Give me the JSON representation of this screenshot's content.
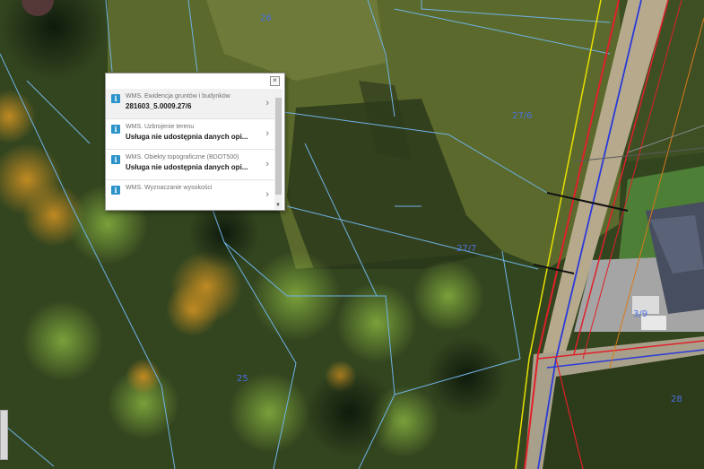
{
  "popup": {
    "close_icon": "close-icon",
    "items": [
      {
        "source": "WMS. Ewidencja gruntów i budynków",
        "value": "281603_5.0009.27/6"
      },
      {
        "source": "WMS. Uzbrojenie terenu",
        "value": "Usługa nie udostępnia danych opi..."
      },
      {
        "source": "WMS. Obiekty topograficzne (BDOT500)",
        "value": "Usługa nie udostępnia danych opi..."
      },
      {
        "source": "WMS. Wyznaczanie wysokości",
        "value": ""
      }
    ]
  },
  "map": {
    "parcel_labels": [
      "27/6",
      "27/7",
      "26",
      "25",
      "3/9",
      "28"
    ],
    "colors": {
      "parcel_lines": "#6fb2e6",
      "road_red": "#e0202a",
      "road_blue": "#2a3ad8",
      "road_yellow": "#e8e000",
      "road_orange": "#d87a18"
    }
  }
}
